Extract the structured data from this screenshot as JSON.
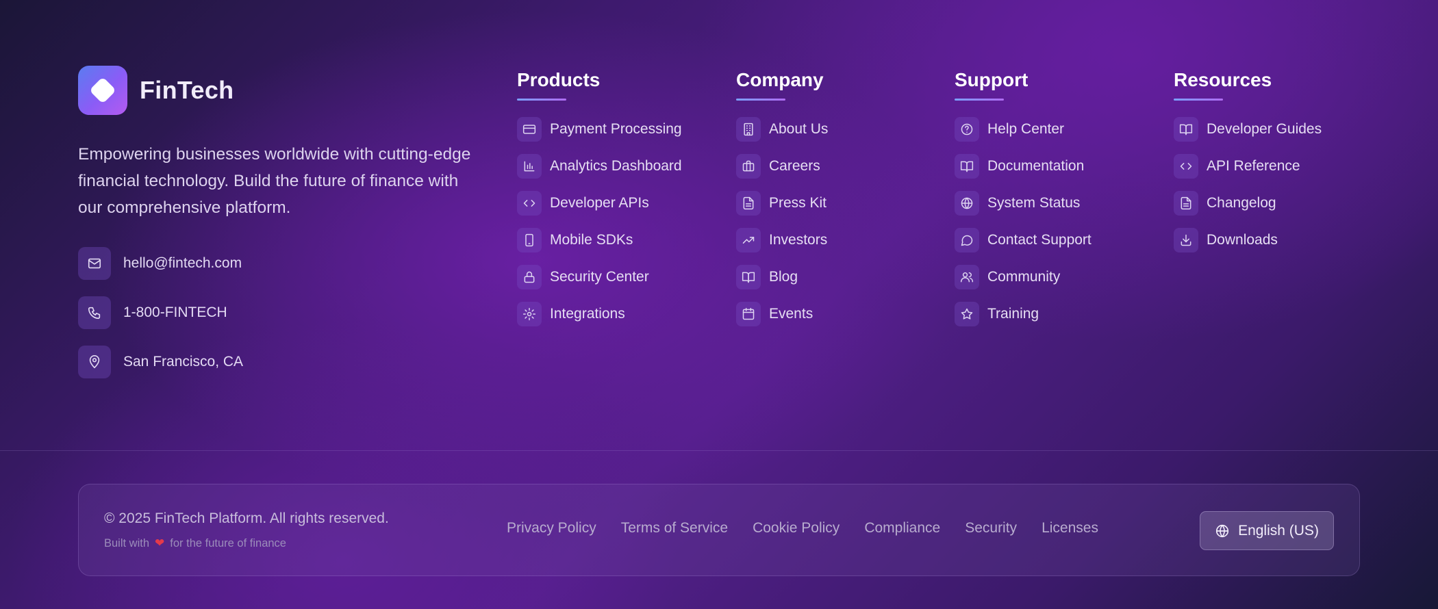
{
  "brand": {
    "name": "FinTech",
    "description": "Empowering businesses worldwide with cutting-edge financial technology. Build the future of finance with our comprehensive platform.",
    "gradient": [
      "#5a7cf0",
      "#8b5cf6",
      "#b45bf0"
    ]
  },
  "contacts": [
    {
      "icon": "mail-icon",
      "text": "hello@fintech.com"
    },
    {
      "icon": "phone-icon",
      "text": "1-800-FINTECH"
    },
    {
      "icon": "map-pin-icon",
      "text": "San Francisco, CA"
    }
  ],
  "columns": [
    {
      "title": "Products",
      "links": [
        {
          "icon": "credit-card-icon",
          "label": "Payment Processing"
        },
        {
          "icon": "bar-chart-icon",
          "label": "Analytics Dashboard"
        },
        {
          "icon": "code-icon",
          "label": "Developer APIs"
        },
        {
          "icon": "smartphone-icon",
          "label": "Mobile SDKs"
        },
        {
          "icon": "lock-icon",
          "label": "Security Center"
        },
        {
          "icon": "gear-icon",
          "label": "Integrations"
        }
      ]
    },
    {
      "title": "Company",
      "links": [
        {
          "icon": "building-icon",
          "label": "About Us"
        },
        {
          "icon": "briefcase-icon",
          "label": "Careers"
        },
        {
          "icon": "file-text-icon",
          "label": "Press Kit"
        },
        {
          "icon": "trending-up-icon",
          "label": "Investors"
        },
        {
          "icon": "book-open-icon",
          "label": "Blog"
        },
        {
          "icon": "calendar-icon",
          "label": "Events"
        }
      ]
    },
    {
      "title": "Support",
      "links": [
        {
          "icon": "help-circle-icon",
          "label": "Help Center"
        },
        {
          "icon": "book-open-icon",
          "label": "Documentation"
        },
        {
          "icon": "globe-icon",
          "label": "System Status"
        },
        {
          "icon": "message-circle-icon",
          "label": "Contact Support"
        },
        {
          "icon": "users-icon",
          "label": "Community"
        },
        {
          "icon": "star-icon",
          "label": "Training"
        }
      ]
    },
    {
      "title": "Resources",
      "links": [
        {
          "icon": "book-open-icon",
          "label": "Developer Guides"
        },
        {
          "icon": "code-icon",
          "label": "API Reference"
        },
        {
          "icon": "file-text-icon",
          "label": "Changelog"
        },
        {
          "icon": "download-icon",
          "label": "Downloads"
        }
      ]
    }
  ],
  "bottom": {
    "copyright": "© 2025 FinTech Platform. All rights reserved.",
    "built_prefix": "Built with",
    "built_suffix": "for the future of finance",
    "heart_color": "#e53a4a",
    "legal_links": [
      "Privacy Policy",
      "Terms of Service",
      "Cookie Policy",
      "Compliance",
      "Security",
      "Licenses"
    ],
    "language": "English (US)"
  }
}
